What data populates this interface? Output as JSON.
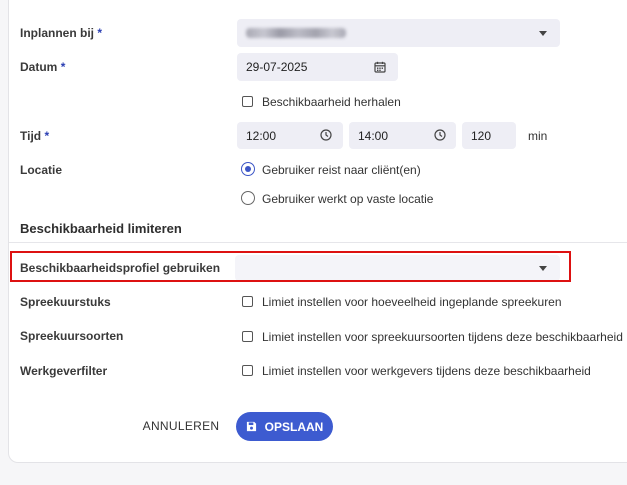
{
  "form": {
    "inplannen": {
      "label": "Inplannen bij",
      "required_mark": "*"
    },
    "datum": {
      "label": "Datum",
      "required_mark": "*",
      "value": "29-07-2025"
    },
    "herhalen": {
      "label": "Beschikbaarheid herhalen",
      "checked": false
    },
    "tijd": {
      "label": "Tijd",
      "required_mark": "*",
      "start": "12:00",
      "end": "14:00",
      "duration": "120",
      "unit": "min"
    },
    "locatie": {
      "label": "Locatie",
      "options": [
        {
          "label": "Gebruiker reist naar cliënt(en)",
          "selected": true
        },
        {
          "label": "Gebruiker werkt op vaste locatie",
          "selected": false
        }
      ]
    }
  },
  "limits": {
    "section_title": "Beschikbaarheid limiteren",
    "profiel": {
      "label": "Beschikbaarheidsprofiel gebruiken",
      "value": ""
    },
    "spreekuurstuks": {
      "label": "Spreekuurstuks",
      "checkbox_label": "Limiet instellen voor hoeveelheid ingeplande spreekuren"
    },
    "spreekuursoorten": {
      "label": "Spreekuursoorten",
      "checkbox_label": "Limiet instellen voor spreekuursoorten tijdens deze beschikbaarheid"
    },
    "werkgeverfilter": {
      "label": "Werkgeverfilter",
      "checkbox_label": "Limiet instellen voor werkgevers tijdens deze beschikbaarheid"
    }
  },
  "actions": {
    "cancel_label": "ANNULEREN",
    "save_label": "OPSLAAN"
  },
  "colors": {
    "accent": "#3d5bd0",
    "highlight": "#dd1111",
    "field_bg": "#eeeef5"
  },
  "icons": {
    "calendar": "calendar-icon",
    "clock": "clock-icon",
    "save": "floppy-disk-icon",
    "dropdown": "caret-down-icon"
  }
}
